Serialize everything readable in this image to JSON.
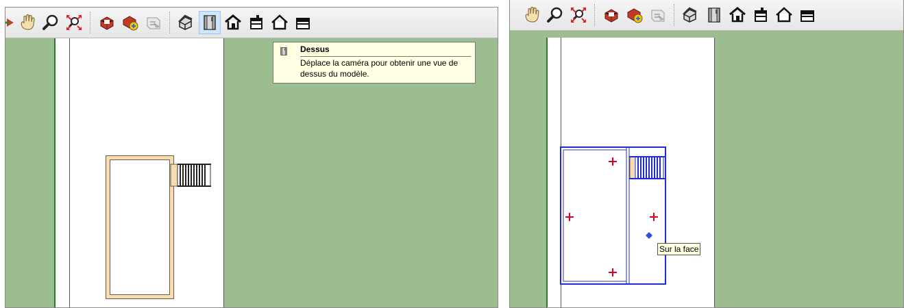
{
  "colors": {
    "grass": "#9bbd8f",
    "road": "#ffffff",
    "road_edge": "#2f7a2a",
    "pool_coping": "#f6dcb1",
    "selection": "#1f2bd6",
    "guide_point": "#e0001a",
    "tooltip_bg": "#ffffe1"
  },
  "left_toolbar": {
    "icons": [
      "orbit-icon",
      "pan-icon",
      "zoom-icon",
      "zoom-extents-icon",
      "separator",
      "get-models-icon",
      "share-model-icon",
      "extension-icon",
      "separator",
      "iso-view-icon",
      "top-view-icon",
      "front-view-icon",
      "right-view-icon",
      "back-view-icon",
      "left-view-icon"
    ],
    "hovered": "top-view-icon"
  },
  "right_toolbar": {
    "icons": [
      "pan-icon",
      "zoom-icon",
      "zoom-extents-icon",
      "separator",
      "get-models-icon",
      "share-model-icon",
      "extension-icon",
      "separator",
      "iso-view-icon",
      "top-view-icon",
      "front-view-icon",
      "right-view-icon",
      "back-view-icon",
      "left-view-icon"
    ]
  },
  "tooltip": {
    "title": "Dessus",
    "description": "Déplace la caméra pour obtenir une vue de dessus du modèle."
  },
  "inference": {
    "label": "Sur la face"
  }
}
